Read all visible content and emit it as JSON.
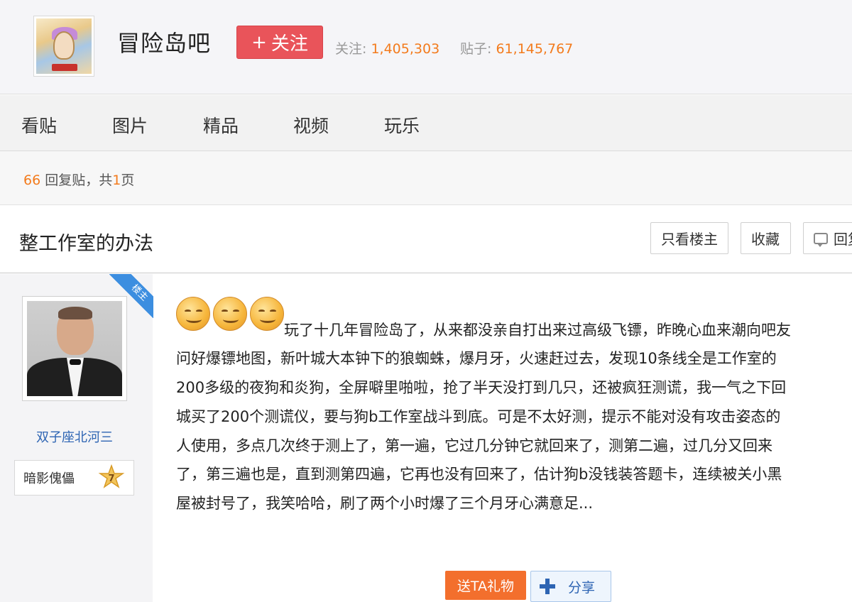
{
  "forum": {
    "name": "冒险岛吧",
    "follow_label": "关注",
    "follow_plus": "+",
    "stats": {
      "follow_label": "关注:",
      "follow_count": "1,405,303",
      "posts_label": "贴子:",
      "posts_count": "61,145,767"
    }
  },
  "nav": [
    "看贴",
    "图片",
    "精品",
    "视频",
    "玩乐"
  ],
  "reply_info": {
    "count": "66",
    "text1": " 回复贴，共",
    "pages": "1",
    "text2": "页"
  },
  "thread": {
    "title": "整工作室的办法",
    "buttons": {
      "author_only": "只看楼主",
      "favorite": "收藏",
      "reply": "回复"
    }
  },
  "post": {
    "author_badge": "楼主",
    "username": "双子座北河三",
    "level_title": "暗影傀儡",
    "level_number": "7",
    "lines": [
      "玩了十几年冒险岛了，从来都没亲自打出来过高级飞镖，昨晚心血来潮向吧友",
      "问好爆镖地图，新叶城大本钟下的狼蜘蛛，爆月牙，火速赶过去，发现10条线全是工作室的",
      "200多级的夜狗和炎狗，全屏噼里啪啦，抢了半天没打到几只，还被疯狂测谎，我一气之下回",
      "城买了200个测谎仪，要与狗b工作室战斗到底。可是不太好测，提示不能对没有攻击姿态的",
      "人使用，多点几次终于测上了，第一遍，它过几分钟它就回来了，测第二遍，过几分又回来",
      "了，第三遍也是，直到测第四遍，它再也没有回来了，估计狗b没钱装答题卡，连续被关小黑",
      "屋被封号了，我笑哈哈，刷了两个小时爆了三个月牙心满意足..."
    ],
    "gift_label": "送TA礼物",
    "share_label": "分享"
  },
  "colors": {
    "accent_orange": "#f37b1d",
    "follow_red": "#e9545a",
    "link_blue": "#2d64b3",
    "ribbon_blue": "#3c8ee0"
  }
}
